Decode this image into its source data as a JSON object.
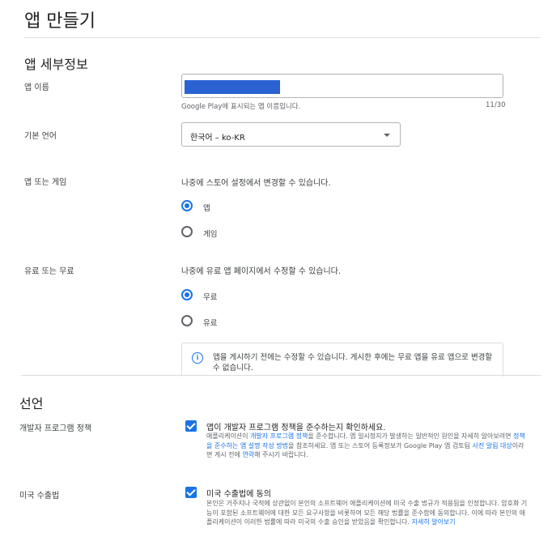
{
  "page": {
    "title": "앱 만들기"
  },
  "details": {
    "section_title": "앱 세부정보",
    "app_name": {
      "label": "앱 이름",
      "helper": "Google Play에 표시되는 앱 이름입니다.",
      "counter": "11/30"
    },
    "language": {
      "label": "기본 언어",
      "value": "한국어 – ko-KR"
    },
    "app_or_game": {
      "label": "앱 또는 게임",
      "hint": "나중에 스토어 설정에서 변경할 수 있습니다.",
      "options": [
        {
          "label": "앱",
          "selected": true
        },
        {
          "label": "게임",
          "selected": false
        }
      ]
    },
    "free_or_paid": {
      "label": "유료 또는 무료",
      "hint": "나중에 유료 앱 페이지에서 수정할 수 있습니다.",
      "options": [
        {
          "label": "무료",
          "selected": true
        },
        {
          "label": "유료",
          "selected": false
        }
      ],
      "info": "앱을 게시하기 전에는 수정할 수 있습니다. 게시한 후에는 무료 앱을 유료 앱으로 변경할 수 없습니다."
    }
  },
  "declarations": {
    "section_title": "선언",
    "policy": {
      "label": "개발자 프로그램 정책",
      "checked": true,
      "title": "앱이 개발자 프로그램 정책을 준수하는지 확인하세요.",
      "desc_1": "애플리케이션이 ",
      "link_1": "개발자 프로그램 정책",
      "desc_2": "을 준수합니다. 앱 일시정지가 발생하는 일반적인 원인을 자세히 알아보려면 ",
      "link_2": "정책을 준수하는 앱 설명 작성 방법",
      "desc_3": "을 참조하세요. 앱 또는 스토어 등록정보가 Google Play 앱 검토팀 ",
      "link_3": "사전 알림 대상",
      "desc_4": "이라면 게시 전에 ",
      "link_4": "연락",
      "desc_5": "해 주시기 바랍니다."
    },
    "export": {
      "label": "미국 수출법",
      "checked": true,
      "title": "미국 수출법에 동의",
      "desc": "본인은 거주지나 국적에 상관없이 본인의 소프트웨어 애플리케이션에 미국 수출 법규가 적용됨을 인정합니다. 암호화 기능이 포함된 소프트웨어에 대한 모든 요구사항을 비롯하여 모든 해당 법률을 준수함에 동의합니다. 이에 따라 본인의 애플리케이션이 이러한 법률에 따라 미국의 수출 승인을 받았음을 확인합니다.",
      "link": "자세히 알아보기"
    }
  },
  "colors": {
    "accent": "#1a73e8",
    "redaction": "#2a62d2"
  },
  "icons": {
    "info": "info-icon",
    "dropdown": "chevron-down-icon",
    "check": "check-icon"
  }
}
